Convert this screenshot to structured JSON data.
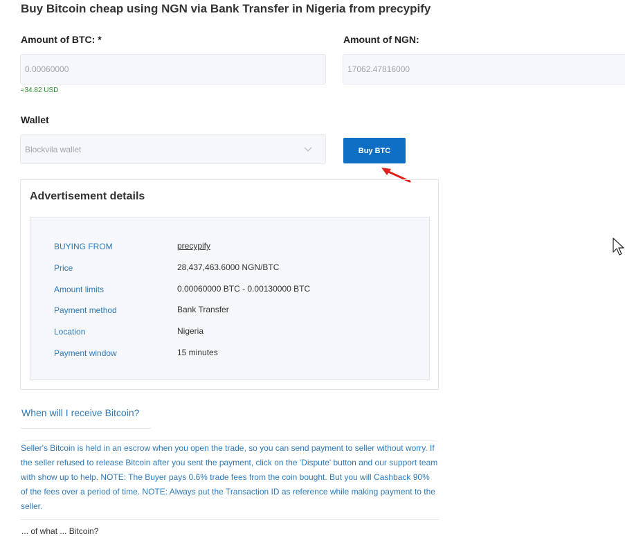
{
  "page": {
    "title": "Buy Bitcoin cheap using NGN via Bank Transfer in Nigeria from precypify"
  },
  "form": {
    "btc_label": "Amount of BTC: *",
    "btc_value": "0.00060000",
    "btc_usd_hint": "≈34.82 USD",
    "ngn_label": "Amount of NGN:",
    "ngn_value": "17062.47816000",
    "wallet_label": "Wallet",
    "wallet_value": "Blockvila wallet",
    "buy_button": "Buy BTC"
  },
  "advertisement": {
    "title": "Advertisement details",
    "rows": [
      {
        "label": "BUYING FROM",
        "value": "precypify"
      },
      {
        "label": "Price",
        "value": "28,437,463.6000 NGN/BTC"
      },
      {
        "label": "Amount limits",
        "value": "0.00060000 BTC - 0.00130000 BTC"
      },
      {
        "label": "Payment method",
        "value": "Bank Transfer"
      },
      {
        "label": "Location",
        "value": "Nigeria"
      },
      {
        "label": "Payment window",
        "value": "15 minutes"
      }
    ]
  },
  "faq": {
    "question": "When will I receive Bitcoin?",
    "answer": "Seller's Bitcoin is held in an escrow when you open the trade, so you can send payment to seller without worry. If the seller refused to release Bitcoin after you sent the payment, click on the 'Dispute' button and our support team with show up to help. NOTE: The Buyer pays 0.6% trade fees from the coin bought. But you will Cashback 90% of the fees over a period of time. NOTE: Always put the Transaction ID as reference while making payment to the seller.",
    "next_partial": "... of what ... Bitcoin?"
  },
  "colors": {
    "accent": "#0f6fc4",
    "link": "#2e7ab9",
    "usd_hint": "#2a8a2a",
    "annotation_arrow": "#e0201c"
  },
  "icons": [
    "chevron-down-icon",
    "annotation-arrow-icon",
    "mouse-cursor-icon"
  ]
}
